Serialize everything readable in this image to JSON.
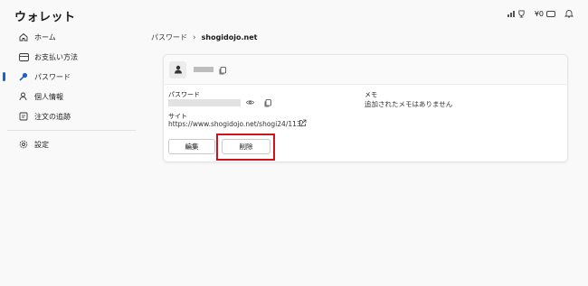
{
  "app": {
    "title": "ウォレット"
  },
  "topbar": {
    "balance": "¥0"
  },
  "sidebar": {
    "items": [
      {
        "label": "ホーム",
        "icon": "home-icon"
      },
      {
        "label": "お支払い方法",
        "icon": "card-icon"
      },
      {
        "label": "パスワード",
        "icon": "key-icon",
        "active": true
      },
      {
        "label": "個人情報",
        "icon": "person-icon"
      },
      {
        "label": "注文の追跡",
        "icon": "package-icon"
      }
    ],
    "settings": {
      "label": "設定",
      "icon": "gear-icon"
    }
  },
  "breadcrumb": {
    "parent": "パスワード",
    "current": "shogidojo.net"
  },
  "details": {
    "password_label": "パスワード",
    "site_label": "サイト",
    "site_url": "https://www.shogidojo.net/shogi24/113/",
    "memo_label": "メモ",
    "memo_value": "追加されたメモはありません"
  },
  "actions": {
    "edit_label": "編集",
    "delete_label": "削除"
  },
  "colors": {
    "accent": "#1f5fc7",
    "highlight": "#d0121b"
  }
}
